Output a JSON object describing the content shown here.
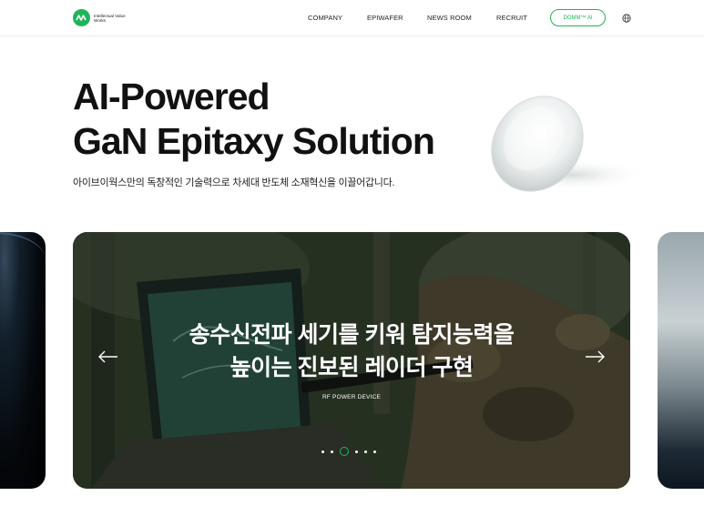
{
  "header": {
    "logo_text": "Intellectual Value Works",
    "nav": [
      "COMPANY",
      "EPIWAFER",
      "NEWS ROOM",
      "RECRUIT"
    ],
    "cta_label": "DOMM™ AI",
    "globe_icon": "globe-icon"
  },
  "hero": {
    "title_line1": "AI-Powered",
    "title_line2": "GaN Epitaxy Solution",
    "subtitle": "아이브이웍스만의 독창적인 기술력으로 차세대 반도체 소재혁신을 이끌어갑니다."
  },
  "carousel": {
    "slide_title_line1": "송수신전파 세기를 키워 탐지능력을",
    "slide_title_line2": "높이는 진보된 레이더 구현",
    "slide_category": "RF POWER DEVICE",
    "prev_icon": "arrow-left-icon",
    "next_icon": "arrow-right-icon",
    "dot_count": 6,
    "active_dot": 2
  },
  "colors": {
    "brand": "#1fb45a",
    "text": "#111111"
  }
}
